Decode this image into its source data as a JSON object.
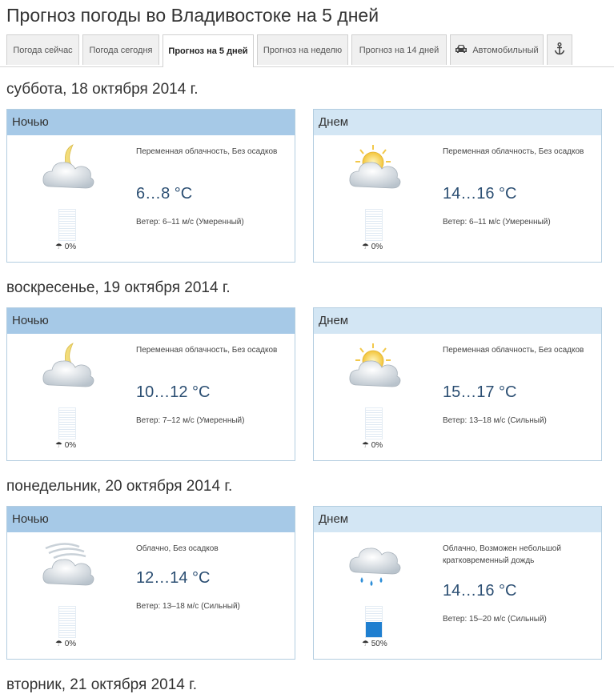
{
  "page": {
    "title": "Прогноз погоды во Владивостоке на 5 дней"
  },
  "tabs": [
    {
      "label": "Погода сейчас"
    },
    {
      "label": "Погода сегодня"
    },
    {
      "label": "Прогноз на 5 дней",
      "active": true
    },
    {
      "label": "Прогноз на неделю"
    },
    {
      "label": "Прогноз на 14 дней"
    },
    {
      "label": "Автомобильный",
      "icon": "car-icon"
    },
    {
      "label": "",
      "icon": "anchor-icon"
    }
  ],
  "days": [
    {
      "title": "суббота, 18 октября 2014 г.",
      "night": {
        "label": "Ночью",
        "icon": "moon-cloud-icon",
        "desc": "Переменная облачность, Без осадков",
        "temp": "6…8 °C",
        "wind": "Ветер:  6–11 м/с (Умеренный)",
        "precip": "0%",
        "precip_fraction": 0
      },
      "day": {
        "label": "Днем",
        "icon": "sun-cloud-icon",
        "desc": "Переменная облачность, Без осадков",
        "temp": "14…16 °C",
        "wind": "Ветер:  6–11 м/с (Умеренный)",
        "precip": "0%",
        "precip_fraction": 0
      }
    },
    {
      "title": "воскресенье, 19 октября 2014 г.",
      "night": {
        "label": "Ночью",
        "icon": "moon-cloud-icon",
        "desc": "Переменная облачность, Без осадков",
        "temp": "10…12 °C",
        "wind": "Ветер:  7–12 м/с (Умеренный)",
        "precip": "0%",
        "precip_fraction": 0
      },
      "day": {
        "label": "Днем",
        "icon": "sun-cloud-icon",
        "desc": "Переменная облачность, Без осадков",
        "temp": "15…17 °C",
        "wind": "Ветер:  13–18 м/с (Сильный)",
        "precip": "0%",
        "precip_fraction": 0
      }
    },
    {
      "title": "понедельник, 20 октября 2014 г.",
      "night": {
        "label": "Ночью",
        "icon": "cloud-wind-icon",
        "desc": "Облачно, Без осадков",
        "temp": "12…14 °C",
        "wind": "Ветер:  13–18 м/с (Сильный)",
        "precip": "0%",
        "precip_fraction": 0
      },
      "day": {
        "label": "Днем",
        "icon": "rain-cloud-icon",
        "desc": "Облачно, Возможен небольшой кратковременный дождь",
        "temp": "14…16 °C",
        "wind": "Ветер:  15–20 м/с (Сильный)",
        "precip": "50%",
        "precip_fraction": 0.5
      }
    },
    {
      "title": "вторник, 21 октября 2014 г."
    }
  ],
  "colors": {
    "night_header": "#a6c9e7",
    "day_header": "#d3e6f4",
    "temp": "#2c4f73",
    "precip_fill": "#1f7fd0"
  }
}
